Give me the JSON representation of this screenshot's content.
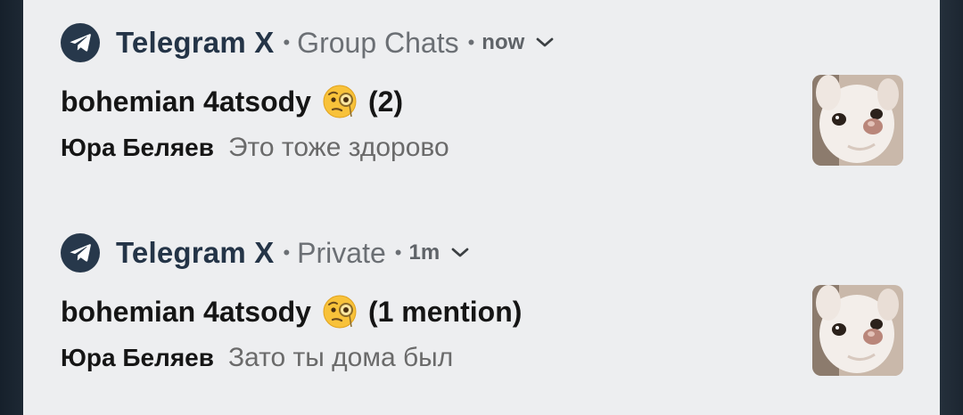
{
  "notifications": [
    {
      "app_name": "Telegram X",
      "separator": "•",
      "channel": "Group Chats",
      "time": "now",
      "title": "bohemian 4atsody",
      "emoji": "face-with-monocle",
      "count_text": "(2)",
      "sender": "Юра Беляев",
      "message": "Это тоже здорово",
      "icon": "telegram-icon",
      "expand_icon": "chevron-down-icon"
    },
    {
      "app_name": "Telegram X",
      "separator": "•",
      "channel": "Private",
      "time": "1m",
      "title": "bohemian 4atsody",
      "emoji": "face-with-monocle",
      "count_text": "(1 mention)",
      "sender": "Юра Беляев",
      "message": "Зато ты дома был",
      "icon": "telegram-icon",
      "expand_icon": "chevron-down-icon"
    }
  ],
  "colors": {
    "panel_bg": "#edeef0",
    "app_name": "#243447",
    "icon_bg": "#27384b",
    "secondary_text": "#6b6f74"
  }
}
